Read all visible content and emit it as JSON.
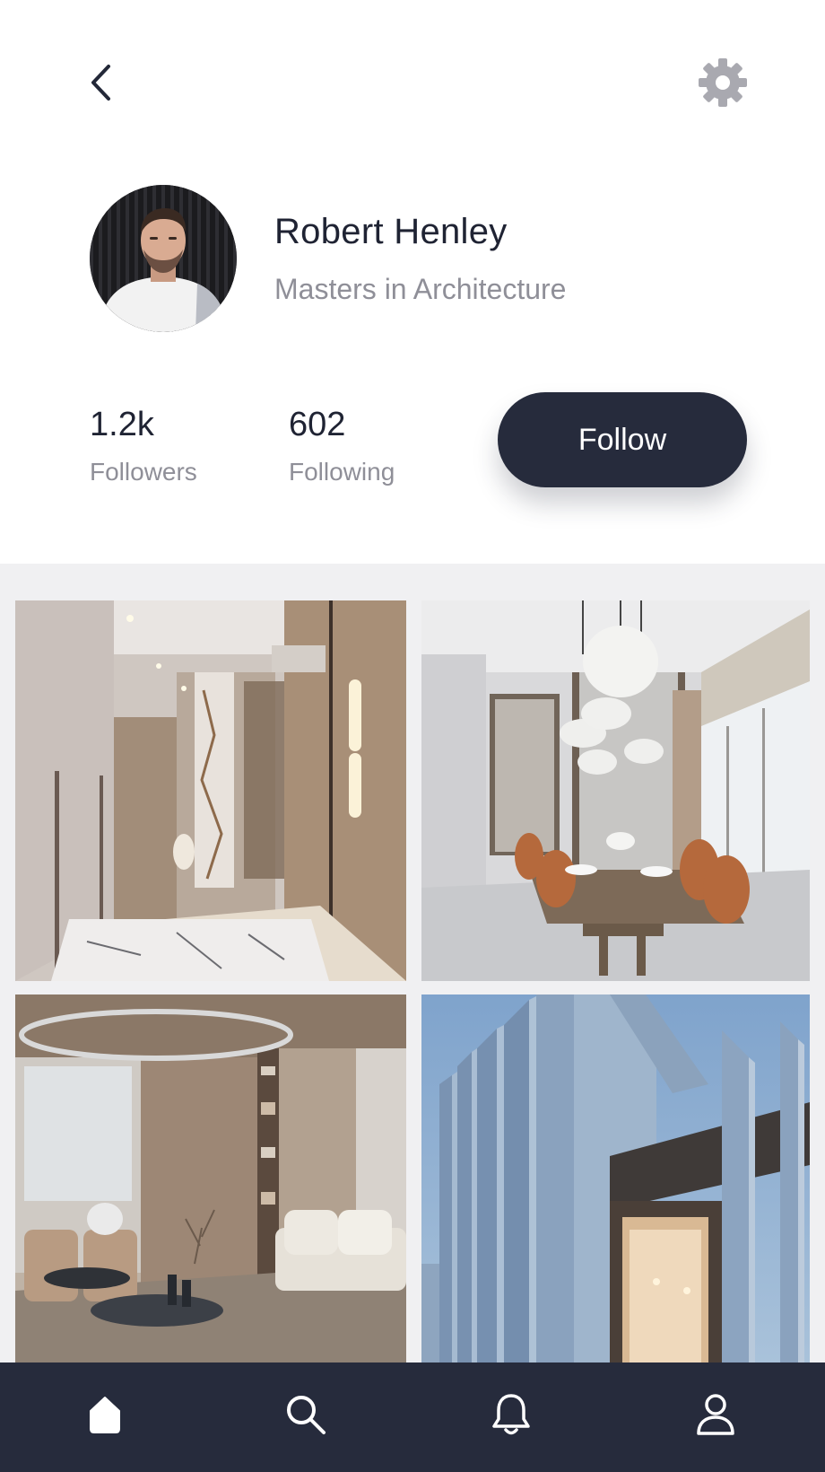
{
  "profile": {
    "name": "Robert Henley",
    "subtitle": "Masters in Architecture",
    "avatar_icon": "profile-photo"
  },
  "stats": {
    "followers": {
      "value": "1.2k",
      "label": "Followers"
    },
    "following": {
      "value": "602",
      "label": "Following"
    }
  },
  "actions": {
    "follow_label": "Follow"
  },
  "icons": {
    "back": "chevron-left-icon",
    "settings": "gear-icon"
  },
  "gallery": [
    {
      "subject": "hallway-interior"
    },
    {
      "subject": "dining-room-interior"
    },
    {
      "subject": "living-room-interior"
    },
    {
      "subject": "building-exterior"
    }
  ],
  "bottom_nav": [
    {
      "icon": "home-icon",
      "active": true
    },
    {
      "icon": "search-icon",
      "active": false
    },
    {
      "icon": "bell-icon",
      "active": false
    },
    {
      "icon": "user-icon",
      "active": false
    }
  ],
  "colors": {
    "primary_dark": "#262b3c",
    "text_secondary": "#8f8f98",
    "gallery_background": "#f0f0f2",
    "settings_icon": "#a9a9b0"
  }
}
